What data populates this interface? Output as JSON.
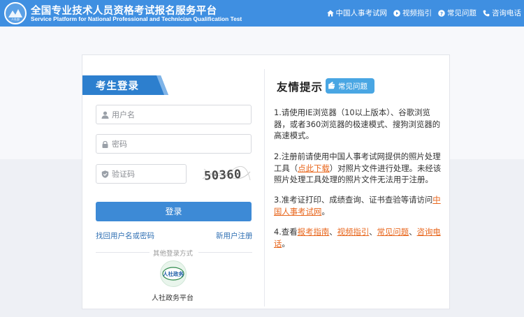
{
  "header": {
    "title_cn": "全国专业技术人员资格考试报名服务平台",
    "title_en": "Service Platform for National Professional and Technician Qualification Test",
    "logo_text": "人社部",
    "nav": [
      "中国人事考试网",
      "视频指引",
      "常见问题",
      "咨询电话"
    ]
  },
  "login": {
    "tab_label": "考生登录",
    "username_placeholder": "用户名",
    "password_placeholder": "密码",
    "captcha_placeholder": "验证码",
    "captcha_text": "50360",
    "login_button": "登录",
    "forgot_link": "找回用户名或密码",
    "register_link": "新用户注册",
    "other_methods": "其他登录方式",
    "gov_platform": "人社政务平台",
    "gov_logo_text": "人社政务"
  },
  "tips": {
    "title": "友情提示",
    "faq_badge": "常见问题",
    "t1": "1.请使用IE浏览器（10以上版本）、谷歌浏览器，或者360浏览器的极速模式、搜狗浏览器的高速模式。",
    "t2_a": "2.注册前请使用中国人事考试网提供的照片处理工具（",
    "t2_link": "点此下载",
    "t2_b": "）对照片文件进行处理。未经该照片处理工具处理的照片文件无法用于注册。",
    "t3_a": "3.准考证打印、成绩查询、证书查验等请访问",
    "t3_link": "中国人事考试网",
    "t3_b": "。",
    "t4_a": "4.查看",
    "t4_l1": "报考指南",
    "t4_sep1": "、",
    "t4_l2": "视频指引",
    "t4_sep2": "、",
    "t4_l3": "常见问题",
    "t4_sep3": "、",
    "t4_l4": "咨询电话",
    "t4_b": "。"
  },
  "colors": {
    "header": "#3f8fe1",
    "accent": "#3d8ad6",
    "link": "#2f6fb3",
    "tip_link": "#e8661c"
  }
}
